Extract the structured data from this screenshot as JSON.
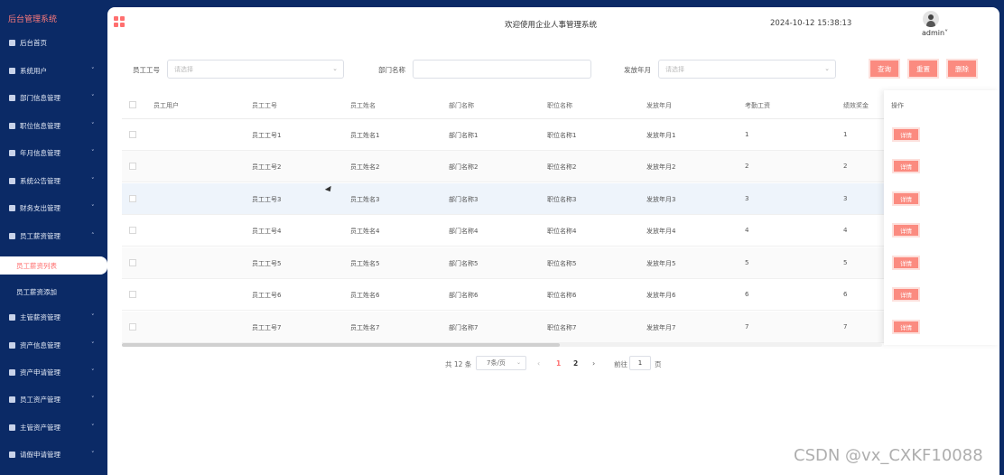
{
  "app_title": "后台管理系统",
  "header": {
    "welcome": "欢迎使用企业人事管理系统",
    "datetime": "2024-10-12 15:38:13",
    "username": "admin˅"
  },
  "sidebar": {
    "items": [
      {
        "label": "后台首页",
        "chevron": ""
      },
      {
        "label": "系统用户",
        "chevron": "˅"
      },
      {
        "label": "部门信息管理",
        "chevron": "˅"
      },
      {
        "label": "职位信息管理",
        "chevron": "˅"
      },
      {
        "label": "年月信息管理",
        "chevron": "˅"
      },
      {
        "label": "系统公告管理",
        "chevron": "˅"
      },
      {
        "label": "财务支出管理",
        "chevron": "˅"
      },
      {
        "label": "员工薪资管理",
        "chevron": "˄"
      }
    ],
    "sub_items": [
      {
        "label": "员工薪资列表",
        "active": true
      },
      {
        "label": "员工薪资添加",
        "active": false
      }
    ],
    "items_after": [
      {
        "label": "主管薪资管理",
        "chevron": "˅"
      },
      {
        "label": "资产信息管理",
        "chevron": "˅"
      },
      {
        "label": "资产申请管理",
        "chevron": "˅"
      },
      {
        "label": "员工资产管理",
        "chevron": "˅"
      },
      {
        "label": "主管资产管理",
        "chevron": "˅"
      },
      {
        "label": "请假申请管理",
        "chevron": "˅"
      }
    ]
  },
  "search": {
    "emp_id_label": "员工工号",
    "emp_id_placeholder": "请选择",
    "dept_label": "部门名称",
    "dept_value": "",
    "month_label": "发放年月",
    "month_placeholder": "请选择",
    "query_button": "查询",
    "reset_button": "重置",
    "delete_button": "删除"
  },
  "table": {
    "columns": [
      "员工用户",
      "员工工号",
      "员工姓名",
      "部门名称",
      "职位名称",
      "发放年月",
      "考勤工资",
      "绩效奖金",
      "操作"
    ],
    "rows": [
      {
        "user": "",
        "emp_id": "员工工号1",
        "name": "员工姓名1",
        "dept": "部门名称1",
        "position": "职位名称1",
        "month": "发放年月1",
        "attendance": "1",
        "bonus": "1",
        "action": "详情"
      },
      {
        "user": "",
        "emp_id": "员工工号2",
        "name": "员工姓名2",
        "dept": "部门名称2",
        "position": "职位名称2",
        "month": "发放年月2",
        "attendance": "2",
        "bonus": "2",
        "action": "详情"
      },
      {
        "user": "",
        "emp_id": "员工工号3",
        "name": "员工姓名3",
        "dept": "部门名称3",
        "position": "职位名称3",
        "month": "发放年月3",
        "attendance": "3",
        "bonus": "3",
        "action": "详情"
      },
      {
        "user": "",
        "emp_id": "员工工号4",
        "name": "员工姓名4",
        "dept": "部门名称4",
        "position": "职位名称4",
        "month": "发放年月4",
        "attendance": "4",
        "bonus": "4",
        "action": "详情"
      },
      {
        "user": "",
        "emp_id": "员工工号5",
        "name": "员工姓名5",
        "dept": "部门名称5",
        "position": "职位名称5",
        "month": "发放年月5",
        "attendance": "5",
        "bonus": "5",
        "action": "详情"
      },
      {
        "user": "",
        "emp_id": "员工工号6",
        "name": "员工姓名6",
        "dept": "部门名称6",
        "position": "职位名称6",
        "month": "发放年月6",
        "attendance": "6",
        "bonus": "6",
        "action": "详情"
      },
      {
        "user": "",
        "emp_id": "员工工号7",
        "name": "员工姓名7",
        "dept": "部门名称7",
        "position": "职位名称7",
        "month": "发放年月7",
        "attendance": "7",
        "bonus": "7",
        "action": "详情"
      }
    ]
  },
  "pagination": {
    "total": "共 12 条",
    "page_size": "7条/页",
    "prev": "‹",
    "pages": [
      "1",
      "2"
    ],
    "current_page": "1",
    "next": "›",
    "goto_label": "前往",
    "goto_value": "1",
    "page_suffix": "页"
  },
  "watermark": "CSDN @vx_CXKF10088",
  "colors": {
    "sidebar_bg": "#0b2a66",
    "accent": "#fb8b80",
    "active_text": "#ff6f6f"
  }
}
